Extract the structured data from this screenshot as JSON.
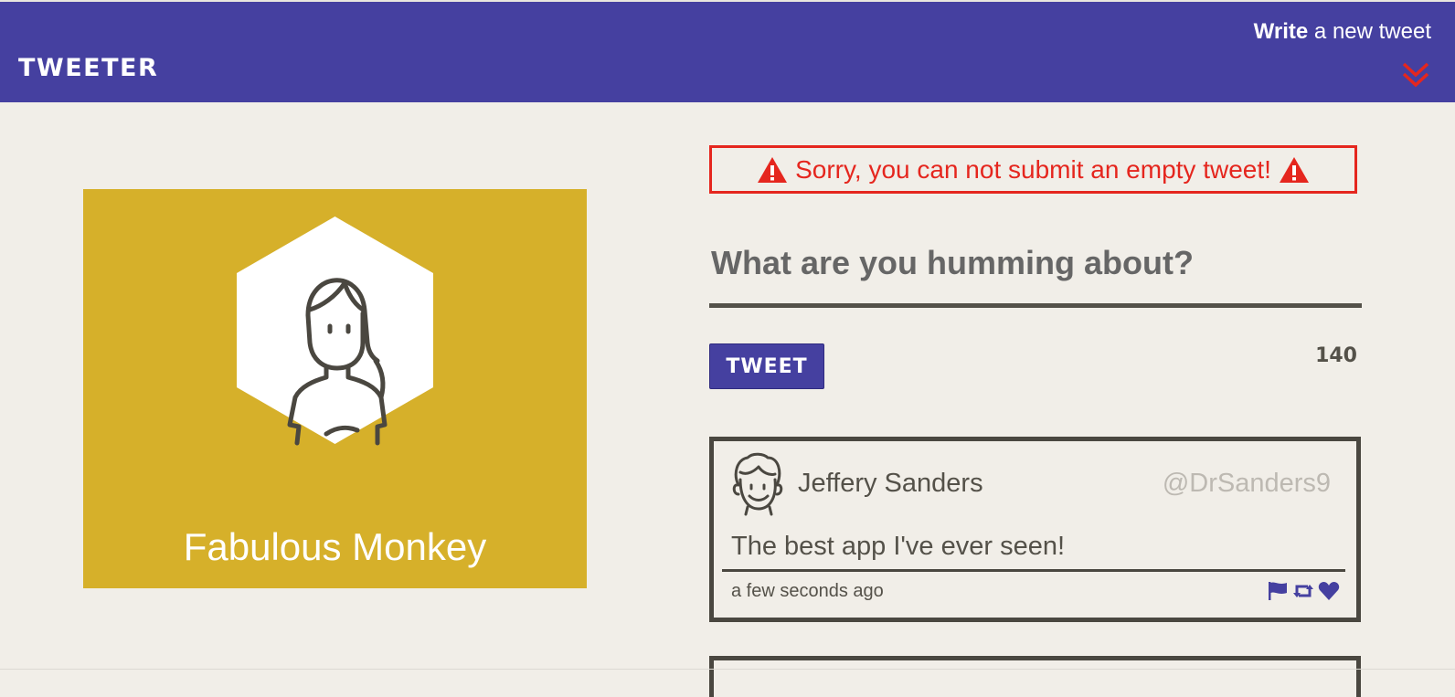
{
  "navbar": {
    "brand": "TWEETER",
    "compose_bold": "Write",
    "compose_rest": "a new tweet",
    "colors": {
      "bar": "#4540a0",
      "chevron": "#e5261e"
    }
  },
  "profile": {
    "name": "Fabulous Monkey",
    "background": "#d6b02a",
    "avatar_icon": "woman-avatar-icon"
  },
  "error": {
    "message": "Sorry, you can not submit an empty tweet!",
    "icon": "warning-triangle-icon",
    "color": "#e5261e"
  },
  "composer": {
    "placeholder": "What are you humming about?",
    "value": "",
    "button_label": "TWEET",
    "char_count": "140"
  },
  "tweets": [
    {
      "author": "Jeffery Sanders",
      "handle": "@DrSanders9",
      "text": "The best app I've ever seen!",
      "time": "a few seconds ago",
      "actions": [
        "flag-icon",
        "retweet-icon",
        "heart-icon"
      ]
    }
  ]
}
